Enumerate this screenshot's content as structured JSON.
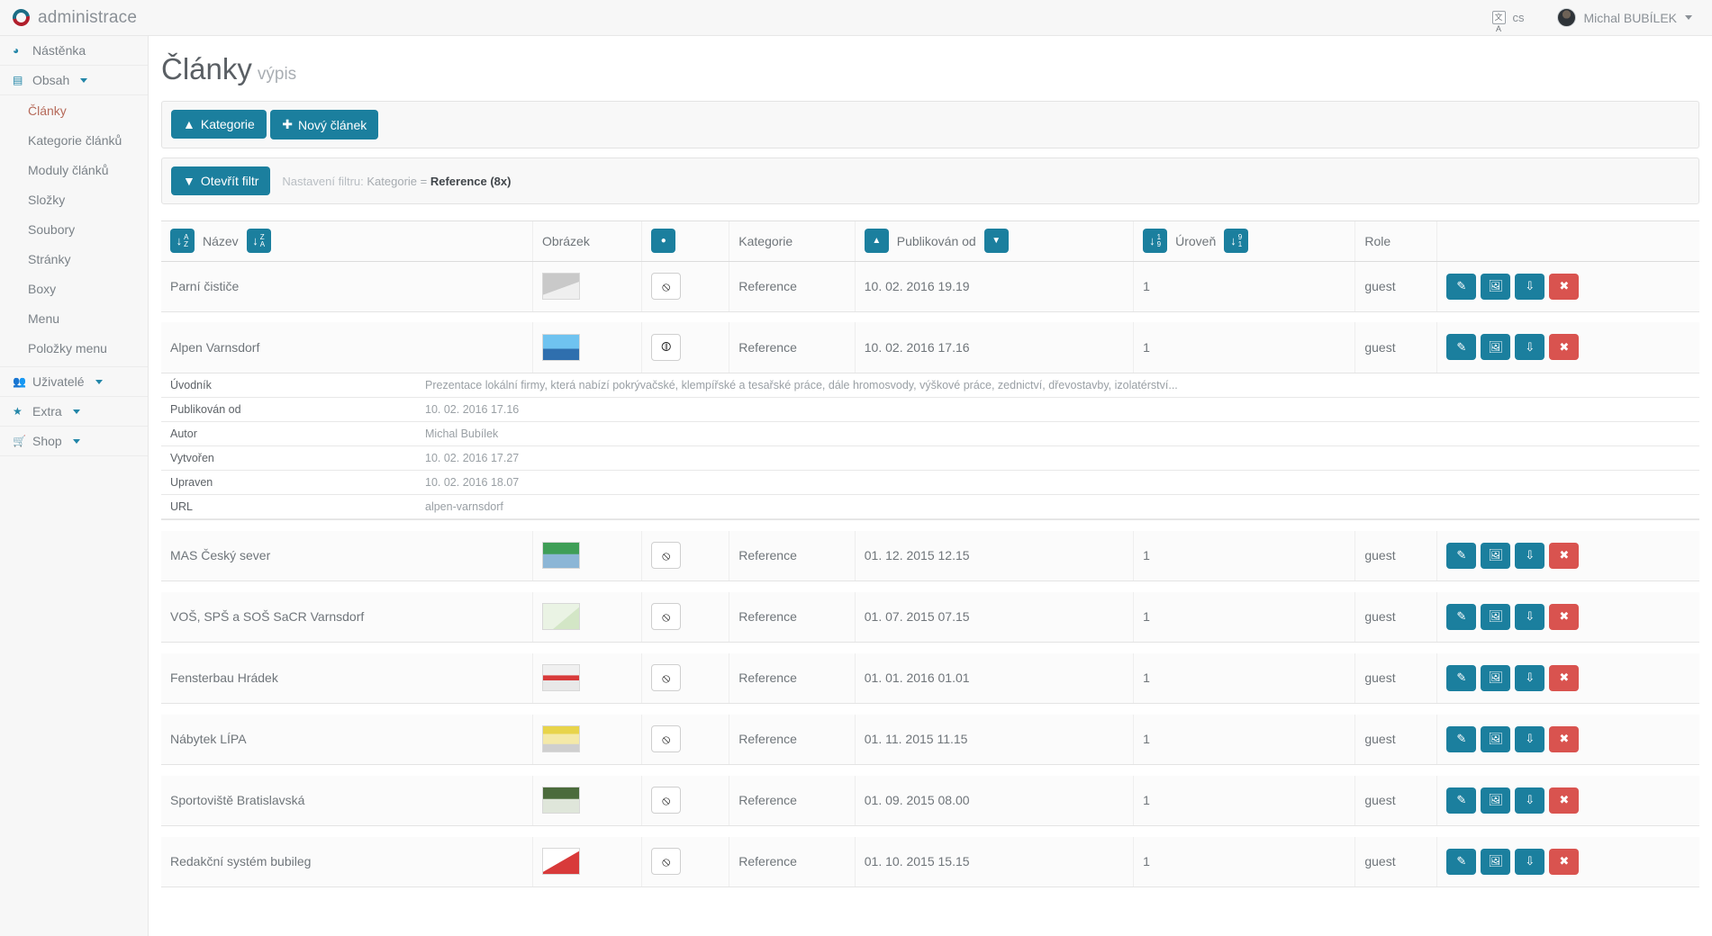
{
  "topbar": {
    "brand": "administrace",
    "language": "cs",
    "language_icon": "translate-icon",
    "user": "Michal BUBÍLEK"
  },
  "sidebar": {
    "items": [
      {
        "label": "Nástěnka",
        "icon": "dashboard-icon",
        "has_caret": false,
        "level": 0
      },
      {
        "label": "Obsah",
        "icon": "sitemap-icon",
        "has_caret": true,
        "level": 0
      },
      {
        "label": "Články",
        "level": 1,
        "active": true
      },
      {
        "label": "Kategorie článků",
        "level": 1,
        "active": false
      },
      {
        "label": "Moduly článků",
        "level": 1,
        "active": false
      },
      {
        "label": "Složky",
        "level": 1,
        "active": false
      },
      {
        "label": "Soubory",
        "level": 1,
        "active": false
      },
      {
        "label": "Stránky",
        "level": 1,
        "active": false
      },
      {
        "label": "Boxy",
        "level": 1,
        "active": false
      },
      {
        "label": "Menu",
        "level": 1,
        "active": false
      },
      {
        "label": "Položky menu",
        "level": 1,
        "active": false
      },
      {
        "label": "Uživatelé",
        "icon": "users-icon",
        "has_caret": true,
        "level": 0
      },
      {
        "label": "Extra",
        "icon": "star-icon",
        "has_caret": true,
        "level": 0
      },
      {
        "label": "Shop",
        "icon": "cart-icon",
        "has_caret": true,
        "level": 0
      }
    ]
  },
  "page": {
    "title": "Články",
    "subtitle": "výpis"
  },
  "toolbar": {
    "kategorie_label": "Kategorie",
    "kategorie_icon": "chevrons-up-icon",
    "novy_clanek_label": "Nový článek",
    "novy_clanek_icon": "plus-icon"
  },
  "filter": {
    "button_label": "Otevřít filtr",
    "button_icon": "chevron-down-icon",
    "prefix": "Nastavení filtru:",
    "field": "Kategorie =",
    "value": "Reference (8x)"
  },
  "table": {
    "columns": {
      "nazev": "Název",
      "obrazek": "Obrázek",
      "kategorie": "Kategorie",
      "publikovan_od": "Publikován od",
      "uroven": "Úroveň",
      "role": "Role"
    },
    "sort_icons": {
      "az": "sort-alpha-asc-icon",
      "za": "sort-alpha-desc-icon",
      "num_asc": "sort-numeric-asc-icon",
      "num_desc": "sort-numeric-desc-icon",
      "up": "caret-up-icon",
      "down": "caret-down-icon",
      "published_toggle": "circle-chevron-icon"
    },
    "actions": {
      "edit": "pencil-icon",
      "image": "picture-icon",
      "expand": "double-chevron-down-icon",
      "delete": "times-icon"
    },
    "rows": [
      {
        "nazev": "Parní čističe",
        "kategorie": "Reference",
        "publikovan_od": "10. 02. 2016 19.19",
        "uroven": "1",
        "role": "guest",
        "expanded": false
      },
      {
        "nazev": "Alpen Varnsdorf",
        "kategorie": "Reference",
        "publikovan_od": "10. 02. 2016 17.16",
        "uroven": "1",
        "role": "guest",
        "expanded": true
      },
      {
        "nazev": "MAS Český sever",
        "kategorie": "Reference",
        "publikovan_od": "01. 12. 2015 12.15",
        "uroven": "1",
        "role": "guest",
        "expanded": false
      },
      {
        "nazev": "VOŠ, SPŠ a SOŠ SaCR Varnsdorf",
        "kategorie": "Reference",
        "publikovan_od": "01. 07. 2015 07.15",
        "uroven": "1",
        "role": "guest",
        "expanded": false
      },
      {
        "nazev": "Fensterbau Hrádek",
        "kategorie": "Reference",
        "publikovan_od": "01. 01. 2016 01.01",
        "uroven": "1",
        "role": "guest",
        "expanded": false
      },
      {
        "nazev": "Nábytek LÍPA",
        "kategorie": "Reference",
        "publikovan_od": "01. 11. 2015 11.15",
        "uroven": "1",
        "role": "guest",
        "expanded": false
      },
      {
        "nazev": "Sportoviště Bratislavská",
        "kategorie": "Reference",
        "publikovan_od": "01. 09. 2015 08.00",
        "uroven": "1",
        "role": "guest",
        "expanded": false
      },
      {
        "nazev": "Redakční systém bubileg",
        "kategorie": "Reference",
        "publikovan_od": "01. 10. 2015 15.15",
        "uroven": "1",
        "role": "guest",
        "expanded": false
      }
    ],
    "detail": {
      "uvodnik_label": "Úvodník",
      "uvodnik_value": "Prezentace lokální firmy, která nabízí pokrývačské, klempířské a tesařské práce, dále hromosvody, výškové práce, zednictví, dřevostavby, izolatérství...",
      "publikovan_label": "Publikován od",
      "publikovan_value": "10. 02. 2016 17.16",
      "autor_label": "Autor",
      "autor_value": "Michal Bubílek",
      "vytvoren_label": "Vytvořen",
      "vytvoren_value": "10. 02. 2016 17.27",
      "upraven_label": "Upraven",
      "upraven_value": "10. 02. 2016 18.07",
      "url_label": "URL",
      "url_value": "alpen-varnsdorf"
    }
  },
  "colors": {
    "accent": "#1b7f9e",
    "danger": "#d9534f",
    "sidebar_bg": "#f7f7f7",
    "active_link": "#b66a5a"
  }
}
